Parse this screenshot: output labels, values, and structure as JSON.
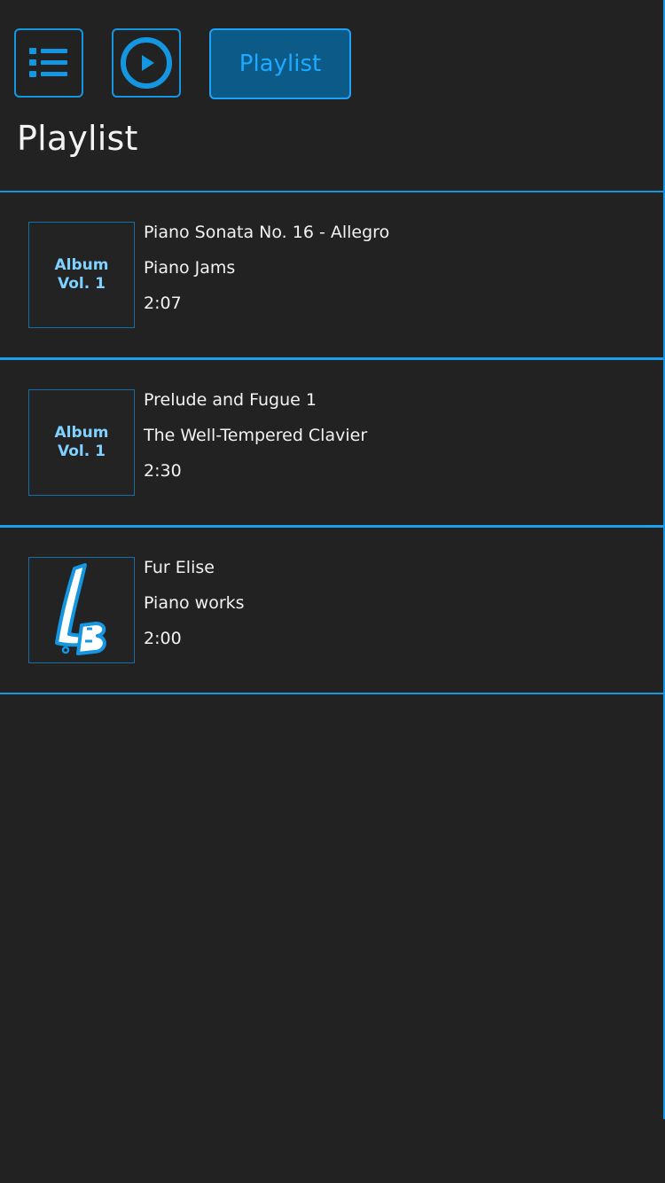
{
  "toolbar": {
    "list_icon": "list-icon",
    "play_icon": "play-circle-icon",
    "tab_label": "Playlist"
  },
  "page": {
    "title": "Playlist"
  },
  "tracks": [
    {
      "title": "Piano Sonata No. 16 - Allegro",
      "album": "Piano Jams",
      "duration": "2:07",
      "cover": {
        "type": "text",
        "line1": "Album",
        "line2": "Vol. 1"
      }
    },
    {
      "title": "Prelude and Fugue 1",
      "album": "The Well-Tempered Clavier",
      "duration": "2:30",
      "cover": {
        "type": "text",
        "line1": "Album",
        "line2": "Vol. 1"
      }
    },
    {
      "title": "Fur Elise",
      "album": "Piano works",
      "duration": "2:00",
      "cover": {
        "type": "logo",
        "logo_text": "LB"
      }
    }
  ],
  "colors": {
    "accent": "#1496e0",
    "background": "#222222",
    "tab_fill": "#0b5a88",
    "cover_text": "#7fd2ff"
  }
}
